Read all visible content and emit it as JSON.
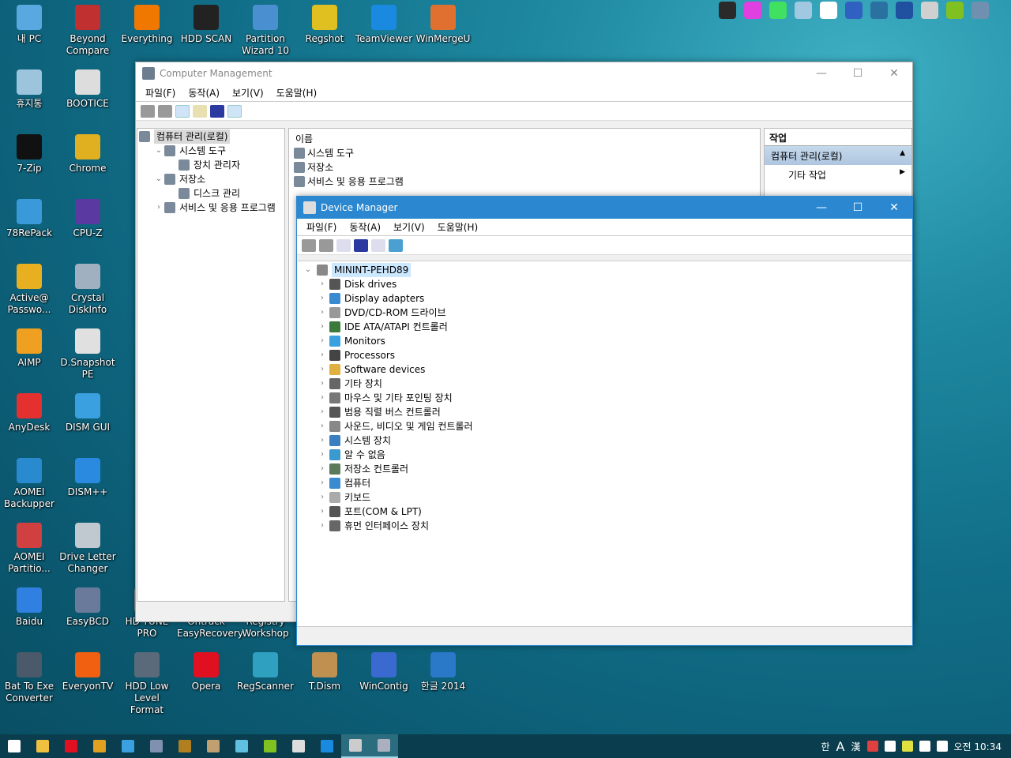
{
  "desktop": {
    "icons": [
      {
        "label": "내 PC",
        "col": 0,
        "row": 0,
        "color": "#5aa8e0",
        "icon": "computer-icon"
      },
      {
        "label": "휴지통",
        "col": 0,
        "row": 1,
        "color": "#9cc4dc",
        "icon": "recycle-bin-icon"
      },
      {
        "label": "7-Zip",
        "col": 0,
        "row": 2,
        "color": "#111111",
        "icon": "7zip-icon"
      },
      {
        "label": "78RePack",
        "col": 0,
        "row": 3,
        "color": "#3a9ad9",
        "icon": "triangle-icon"
      },
      {
        "label": "Active@ Passwo...",
        "col": 0,
        "row": 4,
        "color": "#e8b020",
        "icon": "key-icon"
      },
      {
        "label": "AIMP",
        "col": 0,
        "row": 5,
        "color": "#f0a020",
        "icon": "aimp-icon"
      },
      {
        "label": "AnyDesk",
        "col": 0,
        "row": 6,
        "color": "#e53030",
        "icon": "anydesk-icon"
      },
      {
        "label": "AOMEI Backupper",
        "col": 0,
        "row": 7,
        "color": "#2a8ad0",
        "icon": "backup-icon"
      },
      {
        "label": "AOMEI Partitio...",
        "col": 0,
        "row": 8,
        "color": "#d04040",
        "icon": "partition-icon"
      },
      {
        "label": "Baidu",
        "col": 0,
        "row": 9,
        "color": "#2f80e0",
        "icon": "baidu-icon"
      },
      {
        "label": "Bat To Exe Converter",
        "col": 0,
        "row": 10,
        "color": "#4a5a6a",
        "icon": "gear-icon"
      },
      {
        "label": "Beyond Compare",
        "col": 1,
        "row": 0,
        "color": "#c03030",
        "icon": "beyond-compare-icon"
      },
      {
        "label": "BOOTICE",
        "col": 1,
        "row": 1,
        "color": "#dddddd",
        "icon": "floppy-icon"
      },
      {
        "label": "Chrome",
        "col": 1,
        "row": 2,
        "color": "#e0b020",
        "icon": "chrome-icon"
      },
      {
        "label": "CPU-Z",
        "col": 1,
        "row": 3,
        "color": "#5a3aa0",
        "icon": "cpu-icon"
      },
      {
        "label": "Crystal DiskInfo",
        "col": 1,
        "row": 4,
        "color": "#a0b0c0",
        "icon": "disk-icon"
      },
      {
        "label": "D.Snapshot PE",
        "col": 1,
        "row": 5,
        "color": "#e0e0e0",
        "icon": "drive-icon"
      },
      {
        "label": "DISM GUI",
        "col": 1,
        "row": 6,
        "color": "#3aa0e0",
        "icon": "windows-icon"
      },
      {
        "label": "DISM++",
        "col": 1,
        "row": 7,
        "color": "#2a8ae0",
        "icon": "gears-icon"
      },
      {
        "label": "Drive Letter Changer",
        "col": 1,
        "row": 8,
        "color": "#c0c8d0",
        "icon": "drive-icon"
      },
      {
        "label": "EasyBCD",
        "col": 1,
        "row": 9,
        "color": "#6a7a9a",
        "icon": "computer-icon"
      },
      {
        "label": "EveryonTV",
        "col": 1,
        "row": 10,
        "color": "#f06010",
        "icon": "tv-icon"
      },
      {
        "label": "Everything",
        "col": 2,
        "row": 0,
        "color": "#f07800",
        "icon": "search-icon"
      },
      {
        "label": "HD TUNE PRO",
        "col": 2,
        "row": 9,
        "color": "#888888",
        "icon": "hdd-icon"
      },
      {
        "label": "HDD Low Level Format",
        "col": 2,
        "row": 10,
        "color": "#5a6a7a",
        "icon": "hdd-icon"
      },
      {
        "label": "HDD SCAN",
        "col": 3,
        "row": 0,
        "color": "#222222",
        "icon": "wand-icon"
      },
      {
        "label": "Ontrack EasyRecovery",
        "col": 3,
        "row": 9,
        "color": "#3a6aa0",
        "icon": "recovery-icon"
      },
      {
        "label": "Opera",
        "col": 3,
        "row": 10,
        "color": "#e01020",
        "icon": "opera-icon"
      },
      {
        "label": "Partition Wizard 10",
        "col": 4,
        "row": 0,
        "color": "#4a90d0",
        "icon": "wizard-icon"
      },
      {
        "label": "Registry Workshop",
        "col": 4,
        "row": 9,
        "color": "#3a8a6a",
        "icon": "registry-icon"
      },
      {
        "label": "RegScanner",
        "col": 4,
        "row": 10,
        "color": "#30a0c0",
        "icon": "regscanner-icon"
      },
      {
        "label": "Regshot",
        "col": 5,
        "row": 0,
        "color": "#e0c020",
        "icon": "regshot-icon"
      },
      {
        "label": "T.Dism",
        "col": 5,
        "row": 10,
        "color": "#c09050",
        "icon": "box-icon"
      },
      {
        "label": "TeamViewer",
        "col": 6,
        "row": 0,
        "color": "#1a8ae0",
        "icon": "teamviewer-icon"
      },
      {
        "label": "WinContig",
        "col": 6,
        "row": 10,
        "color": "#3a6ad0",
        "icon": "wincontig-icon"
      },
      {
        "label": "WinMergeU",
        "col": 7,
        "row": 0,
        "color": "#e07030",
        "icon": "winmerge-icon"
      },
      {
        "label": "한글 2014",
        "col": 7,
        "row": 10,
        "color": "#2a78c8",
        "icon": "hangul-icon"
      }
    ]
  },
  "top_tray": [
    {
      "icon": "br-icon",
      "color": "#2a2a2a"
    },
    {
      "icon": "gr-icon",
      "color": "#e040e0"
    },
    {
      "icon": "ir-icon",
      "color": "#40e060"
    },
    {
      "icon": "network-pc-icon",
      "color": "#a0c8e0"
    },
    {
      "icon": "sync-icon",
      "color": "#ffffff"
    },
    {
      "icon": "acronis-icon",
      "color": "#3060c0"
    },
    {
      "icon": "backup-icon",
      "color": "#2a70a0"
    },
    {
      "icon": "clock-icon",
      "color": "#2050a0"
    },
    {
      "icon": "drive-restore-icon",
      "color": "#d0d0d0"
    },
    {
      "icon": "drive-green-icon",
      "color": "#80c020"
    },
    {
      "icon": "time-machine-icon",
      "color": "#7090b0"
    }
  ],
  "comp_mgmt": {
    "title": "Computer Management",
    "menu": [
      "파일(F)",
      "동작(A)",
      "보기(V)",
      "도움말(H)"
    ],
    "tree": [
      {
        "label": "컴퓨터 관리(로컬)",
        "level": 0,
        "chev": "",
        "icon": "computer-mgmt-icon",
        "selected": true
      },
      {
        "label": "시스템 도구",
        "level": 1,
        "chev": "v",
        "icon": "tools-icon"
      },
      {
        "label": "장치 관리자",
        "level": 2,
        "chev": "",
        "icon": "device-manager-icon"
      },
      {
        "label": "저장소",
        "level": 1,
        "chev": "v",
        "icon": "storage-icon"
      },
      {
        "label": "디스크 관리",
        "level": 2,
        "chev": "",
        "icon": "disk-mgmt-icon"
      },
      {
        "label": "서비스 및 응용 프로그램",
        "level": 1,
        "chev": ">",
        "icon": "services-icon"
      }
    ],
    "list_header": "이름",
    "list": [
      {
        "label": "시스템 도구",
        "icon": "tools-icon"
      },
      {
        "label": "저장소",
        "icon": "storage-icon"
      },
      {
        "label": "서비스 및 응용 프로그램",
        "icon": "services-icon"
      }
    ],
    "actions": {
      "header": "작업",
      "section": "컴퓨터 관리(로컬)",
      "item": "기타 작업"
    }
  },
  "device_manager": {
    "title": "Device Manager",
    "menu": [
      "파일(F)",
      "동작(A)",
      "보기(V)",
      "도움말(H)"
    ],
    "root": "MININT-PEHD89",
    "categories": [
      {
        "label": "Disk drives",
        "icon": "disk-drive-icon",
        "color": "#555"
      },
      {
        "label": "Display adapters",
        "icon": "display-adapter-icon",
        "color": "#3a8ad0"
      },
      {
        "label": "DVD/CD-ROM 드라이브",
        "icon": "dvd-icon",
        "color": "#999"
      },
      {
        "label": "IDE ATA/ATAPI 컨트롤러",
        "icon": "ide-controller-icon",
        "color": "#3a7a3a"
      },
      {
        "label": "Monitors",
        "icon": "monitor-icon",
        "color": "#3aa0e0"
      },
      {
        "label": "Processors",
        "icon": "processor-icon",
        "color": "#444"
      },
      {
        "label": "Software devices",
        "icon": "software-device-icon",
        "color": "#e0b040"
      },
      {
        "label": "기타 장치",
        "icon": "other-device-icon",
        "color": "#666"
      },
      {
        "label": "마우스 및 기타 포인팅 장치",
        "icon": "mouse-icon",
        "color": "#777"
      },
      {
        "label": "범용 직렬 버스 컨트롤러",
        "icon": "usb-icon",
        "color": "#555"
      },
      {
        "label": "사운드, 비디오 및 게임 컨트롤러",
        "icon": "sound-icon",
        "color": "#888"
      },
      {
        "label": "시스템 장치",
        "icon": "system-device-icon",
        "color": "#3a80c0"
      },
      {
        "label": "알 수 없음",
        "icon": "unknown-device-icon",
        "color": "#3a9ad0"
      },
      {
        "label": "저장소 컨트롤러",
        "icon": "storage-controller-icon",
        "color": "#5a7a5a"
      },
      {
        "label": "컴퓨터",
        "icon": "computer-icon",
        "color": "#3a8ad0"
      },
      {
        "label": "키보드",
        "icon": "keyboard-icon",
        "color": "#aaa"
      },
      {
        "label": "포트(COM & LPT)",
        "icon": "port-icon",
        "color": "#555"
      },
      {
        "label": "휴먼 인터페이스 장치",
        "icon": "hid-icon",
        "color": "#666"
      }
    ]
  },
  "taskbar": {
    "items": [
      {
        "icon": "start-icon",
        "color": "#ffffff"
      },
      {
        "icon": "file-explorer-icon",
        "color": "#f0c040"
      },
      {
        "icon": "opera-icon",
        "color": "#e01020"
      },
      {
        "icon": "chrome-icon",
        "color": "#e0a020"
      },
      {
        "icon": "dism-gui-icon",
        "color": "#3aa0e0"
      },
      {
        "icon": "easybcd-icon",
        "color": "#8090b0"
      },
      {
        "icon": "br-icon",
        "color": "#b08020"
      },
      {
        "icon": "tdism-icon",
        "color": "#c0a070"
      },
      {
        "icon": "file-icon",
        "color": "#60c0e0"
      },
      {
        "icon": "drive-green-icon",
        "color": "#80c020"
      },
      {
        "icon": "resize-icon",
        "color": "#dddddd"
      },
      {
        "icon": "window-icon",
        "color": "#1a8ae0"
      },
      {
        "icon": "device-manager-icon",
        "color": "#cccccc",
        "active": true
      },
      {
        "icon": "computer-management-icon",
        "color": "#aab0c0",
        "active": true
      }
    ],
    "tray": [
      "한",
      "A",
      "漢"
    ],
    "tray_icons": [
      {
        "icon": "pen-icon",
        "color": "#e04040"
      },
      {
        "icon": "network-icon",
        "color": "#ffffff"
      },
      {
        "icon": "color-icon",
        "color": "#e0e040"
      },
      {
        "icon": "usb-icon",
        "color": "#ffffff"
      },
      {
        "icon": "volume-icon",
        "color": "#ffffff"
      }
    ],
    "clock": "오전 10:34"
  }
}
